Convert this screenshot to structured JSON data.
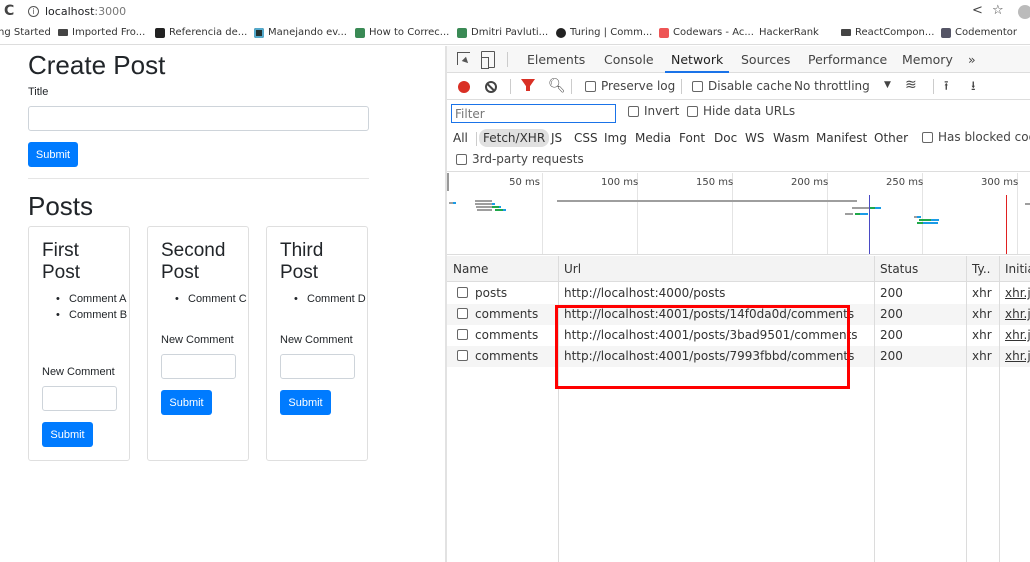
{
  "browser": {
    "reload_icon": "reload-icon",
    "url_host": "localhost",
    "url_port": ":3000",
    "bookmarks": [
      {
        "label": "ng Started",
        "icon": "none"
      },
      {
        "label": "Imported Fro...",
        "icon": "folder-icon"
      },
      {
        "label": "Referencia de...",
        "icon": "m-logo-icon"
      },
      {
        "label": "Manejando ev...",
        "icon": "react-icon"
      },
      {
        "label": "How to Correc...",
        "icon": "dp-icon"
      },
      {
        "label": "Dmitri Pavluti...",
        "icon": "dp-icon"
      },
      {
        "label": "Turing | Comm...",
        "icon": "turing-icon"
      },
      {
        "label": "Codewars - Ac...",
        "icon": "codewars-icon"
      },
      {
        "label": "HackerRank",
        "icon": "hackerrank-icon"
      },
      {
        "label": "ReactCompon...",
        "icon": "folder-icon"
      },
      {
        "label": "Codementor",
        "icon": "codementor-icon"
      }
    ]
  },
  "app": {
    "create_heading": "Create Post",
    "title_label": "Title",
    "title_value": "",
    "submit_label": "Submit",
    "posts_heading": "Posts",
    "posts": [
      {
        "title": "First Post",
        "comments": [
          "Comment A",
          "Comment B"
        ],
        "new_comment_label": "New Comment",
        "new_comment_value": "",
        "submit_label": "Submit"
      },
      {
        "title": "Second Post",
        "comments": [
          "Comment C"
        ],
        "new_comment_label": "New Comment",
        "new_comment_value": "",
        "submit_label": "Submit"
      },
      {
        "title": "Third Post",
        "comments": [
          "Comment D"
        ],
        "new_comment_label": "New Comment",
        "new_comment_value": "",
        "submit_label": "Submit"
      }
    ]
  },
  "devtools": {
    "tabs": [
      "Elements",
      "Console",
      "Network",
      "Sources",
      "Performance",
      "Memory",
      "»"
    ],
    "active_tab": "Network",
    "toolbar": {
      "preserve_log": "Preserve log",
      "preserve_log_checked": false,
      "disable_cache": "Disable cache",
      "disable_cache_checked": false,
      "throttling": "No throttling"
    },
    "filter": {
      "placeholder": "Filter",
      "value": "",
      "invert": "Invert",
      "hide_data_urls": "Hide data URLs",
      "types": [
        "All",
        "Fetch/XHR",
        "JS",
        "CSS",
        "Img",
        "Media",
        "Font",
        "Doc",
        "WS",
        "Wasm",
        "Manifest",
        "Other"
      ],
      "active_type": "Fetch/XHR",
      "has_blocked_cookies": "Has blocked cook",
      "third_party": "3rd-party requests"
    },
    "timeline": {
      "ticks": [
        "50 ms",
        "100 ms",
        "150 ms",
        "200 ms",
        "250 ms",
        "300 ms"
      ],
      "dom_content_loaded_ms": 222,
      "load_ms": 294,
      "colors": {
        "waiting": "#9e9e9e",
        "ttfb": "#1fa84a",
        "download": "#1a9be6",
        "dcl": "#4a4ac4",
        "load": "#e02020"
      }
    },
    "table": {
      "columns": [
        "Name",
        "Url",
        "Status",
        "Ty..",
        "Initia"
      ],
      "rows": [
        {
          "name": "posts",
          "url": "http://localhost:4000/posts",
          "status": "200",
          "type": "xhr",
          "initiator": "xhr.js"
        },
        {
          "name": "comments",
          "url": "http://localhost:4001/posts/14f0da0d/comments",
          "status": "200",
          "type": "xhr",
          "initiator": "xhr.js"
        },
        {
          "name": "comments",
          "url": "http://localhost:4001/posts/3bad9501/comments",
          "status": "200",
          "type": "xhr",
          "initiator": "xhr.js"
        },
        {
          "name": "comments",
          "url": "http://localhost:4001/posts/7993fbbd/comments",
          "status": "200",
          "type": "xhr",
          "initiator": "xhr.js"
        }
      ],
      "highlight_color": "#ff0000"
    }
  }
}
